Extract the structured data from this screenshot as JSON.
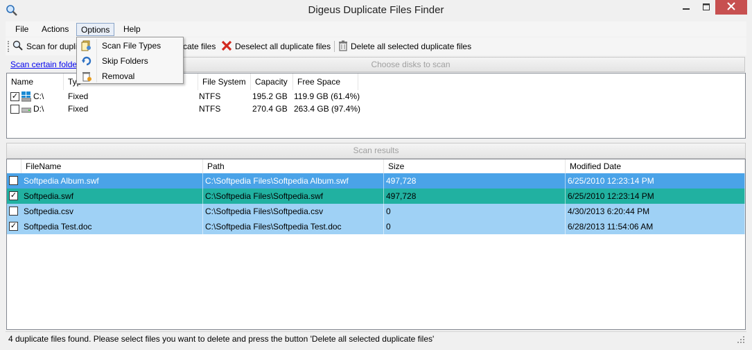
{
  "window": {
    "title": "Digeus Duplicate Files Finder",
    "close_color": "#c75050"
  },
  "menubar": {
    "items": [
      "File",
      "Actions",
      "Options",
      "Help"
    ]
  },
  "toolbar": {
    "scan_label": "Scan for dupli",
    "select_label": "cate files",
    "deselect_label": "Deselect all duplicate files",
    "delete_label": "Delete all selected duplicate files"
  },
  "options_menu": {
    "items": [
      "Scan File Types",
      "Skip Folders",
      "Removal"
    ]
  },
  "disks": {
    "scan_link": "Scan certain folder",
    "header": "Choose disks to scan",
    "columns": [
      "Name",
      "Typ",
      "File System",
      "Capacity",
      "Free Space"
    ],
    "rows": [
      {
        "checked": true,
        "name": "C:\\",
        "type": "Fixed",
        "fs": "NTFS",
        "capacity": "195.2 GB",
        "free": "119.9 GB (61.4%)"
      },
      {
        "checked": false,
        "name": "D:\\",
        "type": "Fixed",
        "fs": "NTFS",
        "capacity": "270.4 GB",
        "free": "263.4 GB (97.4%)"
      }
    ]
  },
  "results": {
    "header": "Scan results",
    "columns": [
      "FileName",
      "Path",
      "Size",
      "Modified Date"
    ],
    "rows": [
      {
        "checked": false,
        "name": "Softpedia Album.swf",
        "path": "C:\\Softpedia Files\\Softpedia Album.swf",
        "size": "497,728",
        "date": "6/25/2010 12:23:14 PM",
        "style": "blue"
      },
      {
        "checked": true,
        "name": "Softpedia.swf",
        "path": "C:\\Softpedia Files\\Softpedia.swf",
        "size": "497,728",
        "date": "6/25/2010 12:23:14 PM",
        "style": "teal"
      },
      {
        "checked": false,
        "name": "Softpedia.csv",
        "path": "C:\\Softpedia Files\\Softpedia.csv",
        "size": "0",
        "date": "4/30/2013 6:20:44 PM",
        "style": "light"
      },
      {
        "checked": true,
        "name": "Softpedia Test.doc",
        "path": "C:\\Softpedia Files\\Softpedia Test.doc",
        "size": "0",
        "date": "6/28/2013 11:54:06 AM",
        "style": "light"
      }
    ]
  },
  "status": {
    "text": "4 duplicate files found. Please select files you want to delete and press the button 'Delete all selected duplicate files'"
  },
  "colors": {
    "row_blue": "#4aa3e8",
    "row_teal": "#21b1a1",
    "row_light": "#9fd1f5"
  }
}
